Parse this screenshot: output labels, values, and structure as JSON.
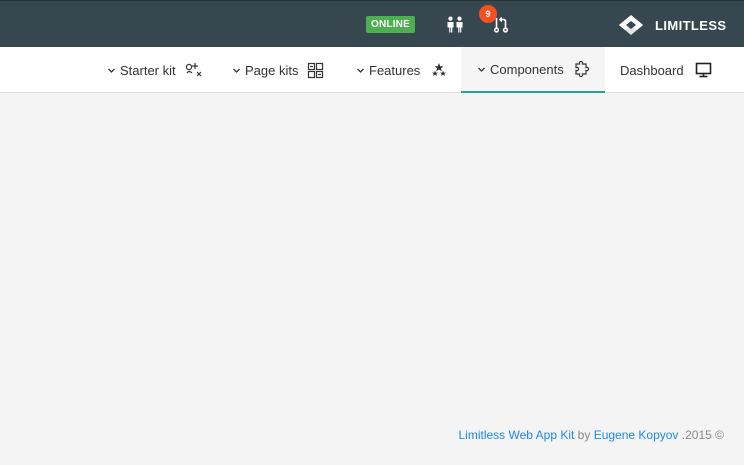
{
  "topbar": {
    "status_badge": "ONLINE",
    "notification_count": "9",
    "brand_name": "LIMITLESS",
    "bg_color": "#37474f",
    "status_color": "#4caf50",
    "badge_color": "#f4511e"
  },
  "nav": {
    "items": [
      {
        "label": "Starter kit",
        "icon": "magic-icon",
        "has_dropdown": true
      },
      {
        "label": "Page kits",
        "icon": "pages-icon",
        "has_dropdown": true
      },
      {
        "label": "Features",
        "icon": "stars-icon",
        "has_dropdown": true
      },
      {
        "label": "Components",
        "icon": "puzzle-icon",
        "has_dropdown": true,
        "active": true
      },
      {
        "label": "Dashboard",
        "icon": "monitor-icon",
        "has_dropdown": false
      }
    ],
    "active_color": "#26a69a"
  },
  "footer": {
    "product_link": "Limitless Web App Kit",
    "by": "by",
    "author_link": "Eugene Kopyov",
    "year": ".2015 ©",
    "link_color": "#1e88e5"
  }
}
